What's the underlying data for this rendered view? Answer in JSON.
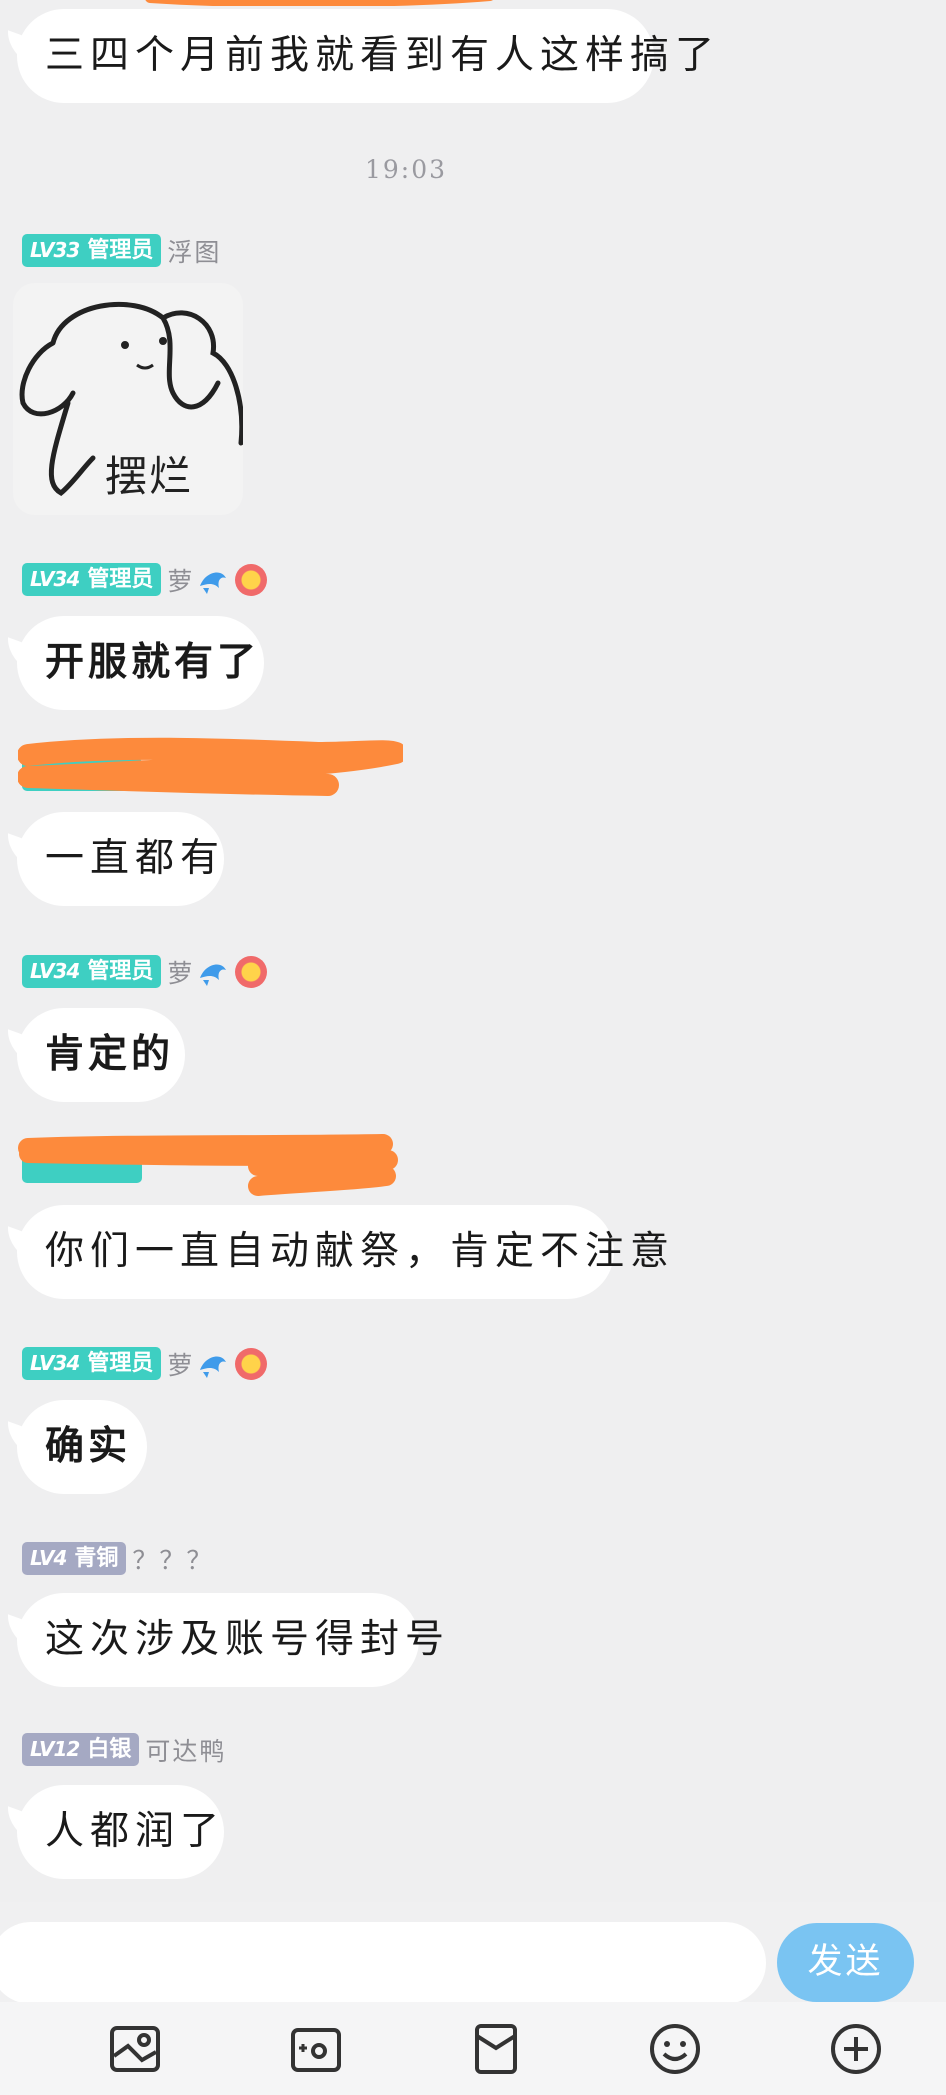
{
  "messages": [
    {
      "text": "三四个月前我就看到有人这样搞了"
    },
    {
      "timestamp": "19:03"
    },
    {
      "sender": {
        "level": "LV33",
        "role": "管理员",
        "name": "浮图"
      },
      "sticker_text": "摆烂"
    },
    {
      "sender": {
        "level": "LV34",
        "role": "管理员",
        "name": "萝"
      },
      "text": "开服就有了"
    },
    {
      "text": "一直都有"
    },
    {
      "sender": {
        "level": "LV34",
        "role": "管理员",
        "name": "萝"
      },
      "text": "肯定的"
    },
    {
      "text": "你们一直自动献祭，肯定不注意"
    },
    {
      "sender": {
        "level": "LV34",
        "role": "管理员",
        "name": "萝"
      },
      "text": "确实"
    },
    {
      "sender": {
        "level": "LV4",
        "role": "青铜",
        "name": "？？？"
      },
      "text": "这次涉及账号得封号"
    },
    {
      "sender": {
        "level": "LV12",
        "role": "白银",
        "name": "可达鸭"
      },
      "text": "人都润了"
    }
  ],
  "input": {
    "placeholder": "",
    "send_label": "发送"
  },
  "toolbar": [
    "image-icon",
    "camera-icon",
    "red-packet-icon",
    "smiley-icon",
    "plus-circle-icon"
  ],
  "colors": {
    "badge_admin": "#3ecfc2",
    "badge_rank": "#a5a9c3",
    "send": "#7ac4f2",
    "redaction": "#fd8a3c",
    "background": "#efeff0"
  }
}
